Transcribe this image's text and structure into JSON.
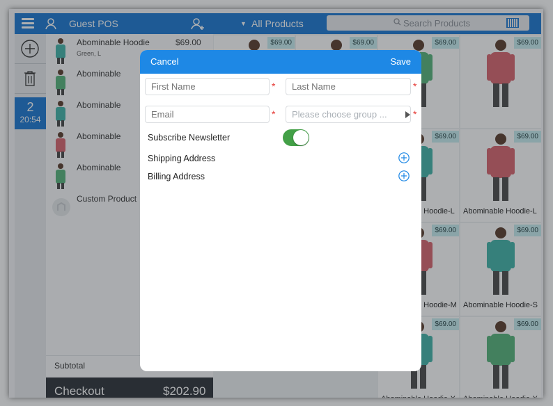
{
  "topbar": {
    "title": "Guest POS",
    "products_filter": "All Products",
    "search_placeholder": "Search Products"
  },
  "order": {
    "number": "2",
    "time": "20:54"
  },
  "cart": {
    "items": [
      {
        "name": "Abominable Hoodie",
        "price": "$69.00",
        "option": "Green, L",
        "color": "#3fb3a8"
      },
      {
        "name": "Abominable",
        "color": "#55b37a"
      },
      {
        "name": "Abominable",
        "color": "#3fb3a8"
      },
      {
        "name": "Abominable",
        "color": "#d9636c"
      },
      {
        "name": "Abominable",
        "color": "#55b37a"
      },
      {
        "name": "Custom Product",
        "color": "#dddddd"
      }
    ],
    "subtotal_label": "Subtotal",
    "checkout_label": "Checkout",
    "checkout_total": "$202.90"
  },
  "products": [
    {
      "price": "$69.00",
      "color": "#d9636c",
      "name": ""
    },
    {
      "price": "$69.00",
      "color": "#3fb3a8",
      "name": ""
    },
    {
      "price": "$69.00",
      "color": "#55b37a",
      "name": ""
    },
    {
      "price": "$69.00",
      "color": "#d9636c",
      "name": ""
    },
    {
      "price": "$69.00",
      "color": "#3fb3a8",
      "name": "Abominable Hoodie-L"
    },
    {
      "price": "$69.00",
      "color": "#d9636c",
      "name": "Abominable Hoodie-L"
    },
    {
      "price": "$69.00",
      "color": "#d9636c",
      "name": "Abominable Hoodie-M"
    },
    {
      "price": "$69.00",
      "color": "#3fb3a8",
      "name": "Abominable Hoodie-S"
    },
    {
      "price": "$69.00",
      "color": "#3fb3a8",
      "name": "Abominable Hoodie-X"
    },
    {
      "price": "$69.00",
      "color": "#55b37a",
      "name": "Abominable Hoodie-X"
    },
    {
      "price": "$69.00",
      "color": "#55b37a",
      "name": ""
    },
    {
      "price": "$69.00",
      "color": "#d9636c",
      "name": ""
    }
  ],
  "modal": {
    "cancel_label": "Cancel",
    "save_label": "Save",
    "first_name_placeholder": "First Name",
    "last_name_placeholder": "Last Name",
    "email_placeholder": "Email",
    "group_placeholder": "Please choose group ...",
    "required_mark": "*",
    "subscribe_label": "Subscribe Newsletter",
    "subscribe_on": true,
    "shipping_label": "Shipping Address",
    "billing_label": "Billing Address"
  },
  "colors": {
    "primary": "#1976d2",
    "modal_header": "#1e88e5",
    "toggle_on": "#43a047",
    "required": "#e53935"
  }
}
